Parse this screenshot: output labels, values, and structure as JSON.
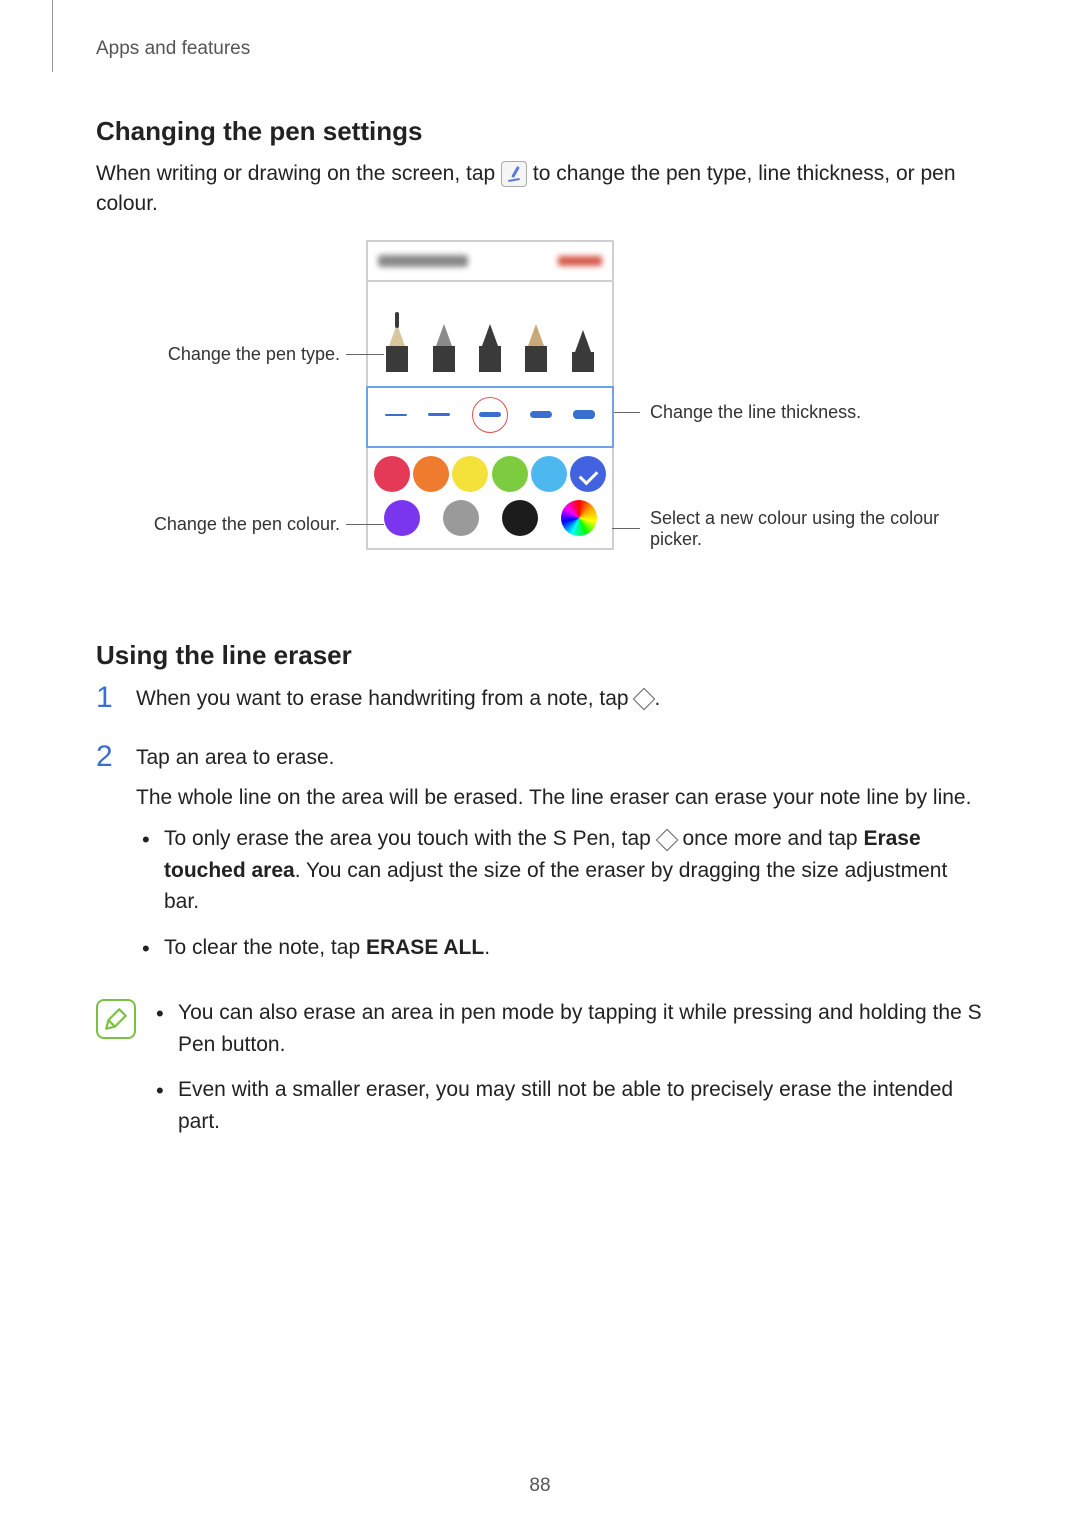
{
  "breadcrumb": "Apps and features",
  "h1": "Changing the pen settings",
  "intro_a": "When writing or drawing on the screen, tap ",
  "intro_b": " to change the pen type, line thickness, or pen colour.",
  "callouts": {
    "pen_type": "Change the pen type.",
    "thickness": "Change the line thickness.",
    "pen_colour": "Change the pen colour.",
    "colour_picker": "Select a new colour using the colour picker."
  },
  "h2": "Using the line eraser",
  "steps": {
    "s1_a": "When you want to erase handwriting from a note, tap ",
    "s1_b": ".",
    "s2_a": "Tap an area to erase.",
    "s2_b": "The whole line on the area will be erased. The line eraser can erase your note line by line.",
    "bullet1_a": "To only erase the area you touch with the S Pen, tap ",
    "bullet1_b": " once more and tap ",
    "bullet1_bold": "Erase touched area",
    "bullet1_c": ". You can adjust the size of the eraser by dragging the size adjustment bar.",
    "bullet2_a": "To clear the note, tap ",
    "bullet2_bold": "ERASE ALL",
    "bullet2_b": "."
  },
  "notes": {
    "n1": "You can also erase an area in pen mode by tapping it while pressing and holding the S Pen button.",
    "n2": "Even with a smaller eraser, you may still not be able to precisely erase the intended part."
  },
  "page_number": "88"
}
